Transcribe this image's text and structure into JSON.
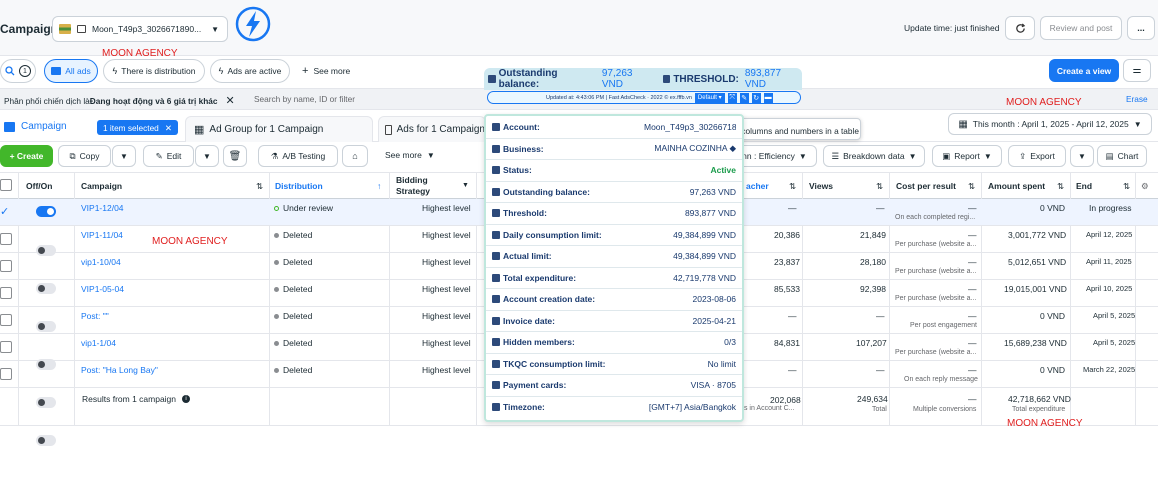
{
  "header": {
    "title": "Campaign",
    "account_name": "Moon_T49p3_3026671890...",
    "update_time": "Update time: just finished",
    "review_label": "Review and post",
    "more_label": "..."
  },
  "watermarks": [
    "MOON AGENCY",
    "MOON AGENCY",
    "MOON AGENCY",
    "MOON AGENCY"
  ],
  "filters": {
    "search_count": "1",
    "all_ads": "All ads",
    "distribution": "There is distribution",
    "active": "Ads are active",
    "see_more": "See more",
    "create_view": "Create a view"
  },
  "filter_bar": {
    "chip": "Phân phối chiến dịch là ",
    "chip_bold": "Đang hoạt động và 6 giá trị khác",
    "placeholder": "Search by name, ID or filter",
    "erase": "Erase"
  },
  "tabs": {
    "campaign": "Campaign",
    "selected": "1 item selected",
    "adgroup": "Ad Group for 1 Campaign",
    "ads": "Ads for 1 Campaign",
    "daterange": "This month : April 1, 2025 - April 12, 2025"
  },
  "toolbar": {
    "create": "+ Create",
    "copy": "Copy",
    "edit": "Edit",
    "abtest": "A/B Testing",
    "see_more": "See more",
    "columns": "nn : Efficiency",
    "breakdown": "Breakdown data",
    "report": "Report",
    "export": "Export",
    "chart": "Chart"
  },
  "table": {
    "headers": {
      "onoff": "Off/On",
      "campaign": "Campaign",
      "distribution": "Distribution",
      "bidding": "Bidding Strategy",
      "reach": "acher",
      "views": "Views",
      "cpr": "Cost per result",
      "spent": "Amount spent",
      "end": "End"
    },
    "rows": [
      {
        "name": "VIP1-12/04",
        "status": "Under review",
        "bidding": "Highest level",
        "reach": "—",
        "views": "—",
        "cpr": "—",
        "cpr_sub": "On each completed regi...",
        "spent": "0 VND",
        "end": "In progress"
      },
      {
        "name": "VIP1-11/04",
        "status": "Deleted",
        "bidding": "Highest level",
        "reach": "20,386",
        "views": "21,849",
        "cpr": "—",
        "cpr_sub": "Per purchase (website a...",
        "spent": "3,001,772 VND",
        "end": "April 12, 2025"
      },
      {
        "name": "vip1-10/04",
        "status": "Deleted",
        "bidding": "Highest level",
        "reach": "23,837",
        "views": "28,180",
        "cpr": "—",
        "cpr_sub": "Per purchase (website a...",
        "spent": "5,012,651 VND",
        "end": "April 11, 2025"
      },
      {
        "name": "VIP1-05-04",
        "status": "Deleted",
        "bidding": "Highest level",
        "reach": "85,533",
        "views": "92,398",
        "cpr": "—",
        "cpr_sub": "Per purchase (website a...",
        "spent": "19,015,001 VND",
        "end": "April 10, 2025"
      },
      {
        "name": "Post: \"\"",
        "status": "Deleted",
        "bidding": "Highest level",
        "reach": "—",
        "views": "—",
        "cpr": "—",
        "cpr_sub": "Per post engagement",
        "spent": "0 VND",
        "end": "April 5, 2025"
      },
      {
        "name": "vip1-1/04",
        "status": "Deleted",
        "bidding": "Highest level",
        "reach": "84,831",
        "views": "107,207",
        "cpr": "—",
        "cpr_sub": "Per purchase (website a...",
        "spent": "15,689,238 VND",
        "end": "April 5, 2025"
      },
      {
        "name": "Post: \"Ha Long Bay\"",
        "status": "Deleted",
        "bidding": "Highest level",
        "reach": "—",
        "views": "—",
        "cpr": "—",
        "cpr_sub": "On each reply message",
        "spent": "0 VND",
        "end": "March 22, 2025"
      }
    ],
    "footer": {
      "results": "Results from 1 campaign",
      "reach": "202,068",
      "reach_sub": "ts in Account C...",
      "views": "249,634",
      "views_sub": "Total",
      "cpr": "—",
      "cpr_sub": "Multiple conversions",
      "spent": "42,718,662 VND",
      "spent_sub": "Total expenditure"
    }
  },
  "popup": {
    "outstanding_label": "Outstanding balance:",
    "outstanding_value": "97,263 VND",
    "threshold_label": "THRESHOLD:",
    "threshold_value": "893,877 VND",
    "updated": "Updated at: 4:43:06 PM | Fast AdsCheck · 2022 © ex.fffb.vn",
    "default_btn": "Default",
    "tooltip": "Change columns and numbers in a table",
    "rows": [
      {
        "label": "Account:",
        "value": "Moon_T49p3_30266718",
        "green": false
      },
      {
        "label": "Business:",
        "value": "MAINHA COZINHA ◆",
        "green": false
      },
      {
        "label": "Status:",
        "value": "Active",
        "green": true
      },
      {
        "label": "Outstanding balance:",
        "value": "97,263 VND",
        "green": false
      },
      {
        "label": "Threshold:",
        "value": "893,877 VND",
        "green": false
      },
      {
        "label": "Daily consumption limit:",
        "value": "49,384,899 VND",
        "green": false
      },
      {
        "label": "Actual limit:",
        "value": "49,384,899 VND",
        "green": false
      },
      {
        "label": "Total expenditure:",
        "value": "42,719,778 VND",
        "green": false
      },
      {
        "label": "Account creation date:",
        "value": "2023-08-06",
        "green": false
      },
      {
        "label": "Invoice date:",
        "value": "2025-04-21",
        "green": false
      },
      {
        "label": "Hidden members:",
        "value": "0/3",
        "green": false
      },
      {
        "label": "TKQC consumption limit:",
        "value": "No limit",
        "green": false
      },
      {
        "label": "Payment cards:",
        "value": "VISA · 8705",
        "green": false
      },
      {
        "label": "Timezone:",
        "value": "[GMT+7] Asia/Bangkok",
        "green": false
      }
    ]
  }
}
